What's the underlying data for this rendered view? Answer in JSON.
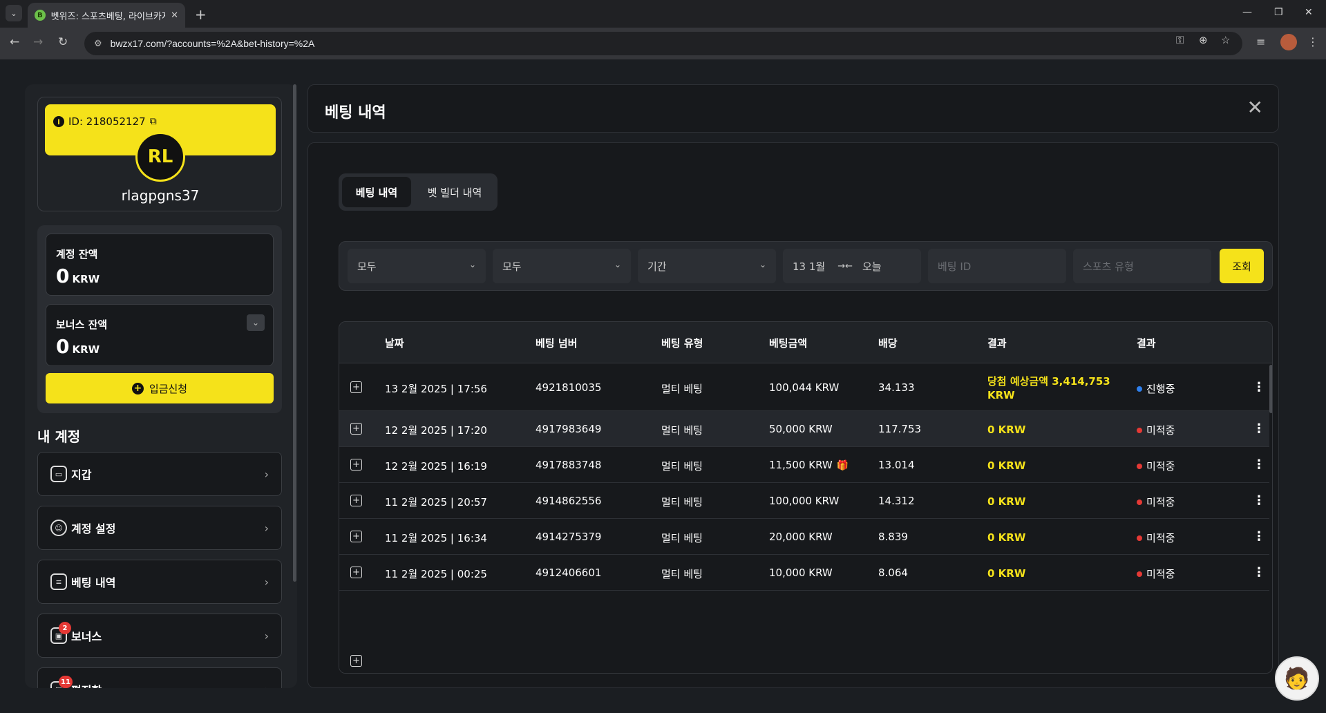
{
  "browser": {
    "tab_title": "벳위즈: 스포츠베팅, 라이브카지",
    "url": "bwzx17.com/?accounts=%2A&bet-history=%2A",
    "favicon_letter": "B"
  },
  "sidebar": {
    "profile": {
      "id_label": "ID: 218052127",
      "initials": "RL",
      "username": "rlagpgns37"
    },
    "account_balance": {
      "label": "계정 잔액",
      "value": "0",
      "unit": "KRW"
    },
    "bonus_balance": {
      "label": "보너스 잔액",
      "value": "0",
      "unit": "KRW"
    },
    "deposit_label": "입금신청",
    "my_account_title": "내 계정",
    "menu": [
      {
        "label": "지갑",
        "icon": "wallet-icon"
      },
      {
        "label": "계정 설정",
        "icon": "user-settings-icon"
      },
      {
        "label": "베팅 내역",
        "icon": "bet-history-icon"
      },
      {
        "label": "보너스",
        "icon": "gift-icon",
        "badge": "2"
      },
      {
        "label": "편지함",
        "icon": "inbox-icon",
        "badge": "11"
      }
    ]
  },
  "main": {
    "title": "베팅 내역",
    "tabs": [
      {
        "label": "베팅 내역",
        "active": true
      },
      {
        "label": "벳 빌더 내역",
        "active": false
      }
    ],
    "filters": {
      "select1": "모두",
      "select2": "모두",
      "period": "기간",
      "date_from": "13 1월",
      "date_to": "오늘",
      "bet_id_placeholder": "베팅 ID",
      "sport_type_placeholder": "스포츠 유형",
      "search_label": "조회"
    },
    "table": {
      "headers": [
        "날짜",
        "베팅 넘버",
        "베팅 유형",
        "베팅금액",
        "배당",
        "결과",
        "결과"
      ],
      "rows": [
        {
          "date": "13 2월 2025 | 17:56",
          "number": "4921810035",
          "type": "멀티 베팅",
          "amount": "100,044 KRW",
          "odds": "34.133",
          "result_line1": "당첨 예상금액 3,414,753",
          "result_line2": "KRW",
          "status": "진행중",
          "status_color": "#2f80ed"
        },
        {
          "date": "12 2월 2025 | 17:20",
          "number": "4917983649",
          "type": "멀티 베팅",
          "amount": "50,000 KRW",
          "odds": "117.753",
          "result_line1": "0 KRW",
          "result_line2": "",
          "status": "미적중",
          "status_color": "#e53935"
        },
        {
          "date": "12 2월 2025 | 16:19",
          "number": "4917883748",
          "type": "멀티 베팅",
          "amount": "11,500 KRW",
          "odds": "13.014",
          "result_line1": "0 KRW",
          "result_line2": "",
          "status": "미적중",
          "status_color": "#e53935",
          "gift": true
        },
        {
          "date": "11 2월 2025 | 20:57",
          "number": "4914862556",
          "type": "멀티 베팅",
          "amount": "100,000 KRW",
          "odds": "14.312",
          "result_line1": "0 KRW",
          "result_line2": "",
          "status": "미적중",
          "status_color": "#e53935"
        },
        {
          "date": "11 2월 2025 | 16:34",
          "number": "4914275379",
          "type": "멀티 베팅",
          "amount": "20,000 KRW",
          "odds": "8.839",
          "result_line1": "0 KRW",
          "result_line2": "",
          "status": "미적중",
          "status_color": "#e53935"
        },
        {
          "date": "11 2월 2025 | 00:25",
          "number": "4912406601",
          "type": "멀티 베팅",
          "amount": "10,000 KRW",
          "odds": "8.064",
          "result_line1": "0 KRW",
          "result_line2": "",
          "status": "미적중",
          "status_color": "#e53935"
        }
      ]
    }
  },
  "colors": {
    "accent": "#f5e21a",
    "background": "#1b1e22",
    "panel": "#17191c",
    "pending": "#2f80ed",
    "lost": "#e53935"
  }
}
